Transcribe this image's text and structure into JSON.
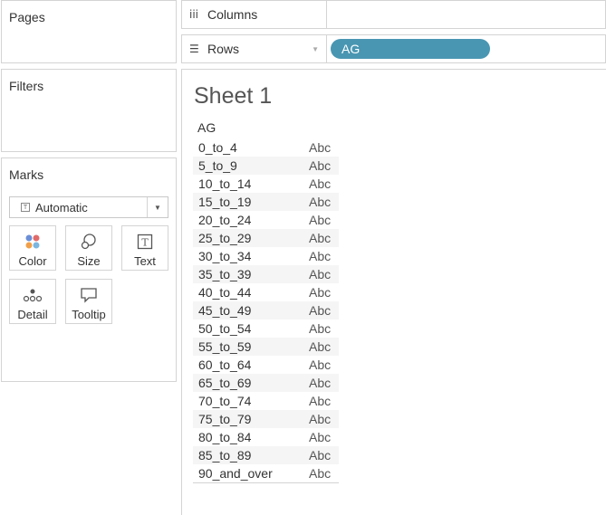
{
  "panels": {
    "pages_title": "Pages",
    "filters_title": "Filters",
    "marks_title": "Marks"
  },
  "marks": {
    "type_selected": "Automatic",
    "buttons": {
      "color": "Color",
      "size": "Size",
      "text": "Text",
      "detail": "Detail",
      "tooltip": "Tooltip"
    },
    "color_dots": [
      "#6b8fd6",
      "#e06b6b",
      "#f0a04a",
      "#7ab6e0"
    ]
  },
  "shelves": {
    "columns_label": "Columns",
    "rows_label": "Rows",
    "rows_pill": "AG",
    "pill_color": "#4996b2"
  },
  "sheet": {
    "title": "Sheet 1",
    "column_header": "AG",
    "rows": [
      {
        "label": "0_to_4",
        "value": "Abc"
      },
      {
        "label": "5_to_9",
        "value": "Abc"
      },
      {
        "label": "10_to_14",
        "value": "Abc"
      },
      {
        "label": "15_to_19",
        "value": "Abc"
      },
      {
        "label": "20_to_24",
        "value": "Abc"
      },
      {
        "label": "25_to_29",
        "value": "Abc"
      },
      {
        "label": "30_to_34",
        "value": "Abc"
      },
      {
        "label": "35_to_39",
        "value": "Abc"
      },
      {
        "label": "40_to_44",
        "value": "Abc"
      },
      {
        "label": "45_to_49",
        "value": "Abc"
      },
      {
        "label": "50_to_54",
        "value": "Abc"
      },
      {
        "label": "55_to_59",
        "value": "Abc"
      },
      {
        "label": "60_to_64",
        "value": "Abc"
      },
      {
        "label": "65_to_69",
        "value": "Abc"
      },
      {
        "label": "70_to_74",
        "value": "Abc"
      },
      {
        "label": "75_to_79",
        "value": "Abc"
      },
      {
        "label": "80_to_84",
        "value": "Abc"
      },
      {
        "label": "85_to_89",
        "value": "Abc"
      },
      {
        "label": "90_and_over",
        "value": "Abc"
      }
    ]
  }
}
